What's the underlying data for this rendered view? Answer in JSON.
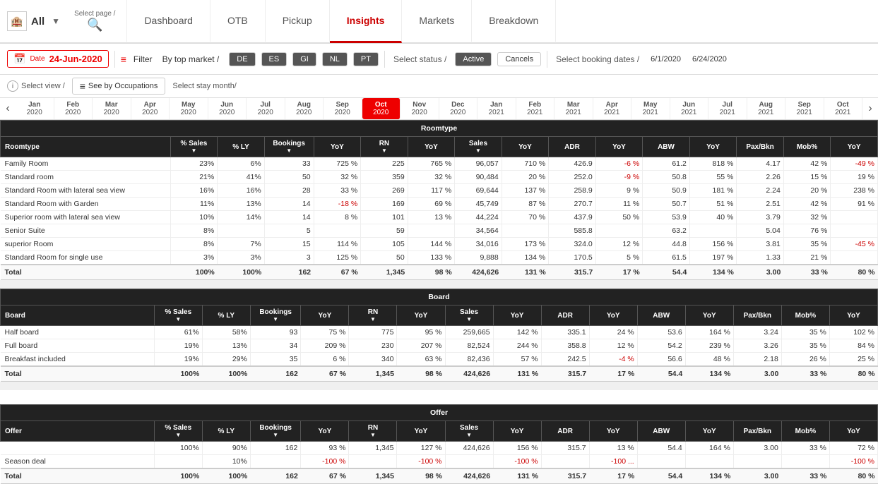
{
  "nav": {
    "logo_label": "All",
    "select_page_label": "Select page /",
    "dashboard": "Dashboard",
    "otb": "OTB",
    "pickup": "Pickup",
    "insights": "Insights",
    "markets": "Markets",
    "breakdown": "Breakdown"
  },
  "filter": {
    "date_label": "Date",
    "date_value": "24-Jun-2020",
    "filter_label": "Filter",
    "by_market": "By top market /",
    "markets": [
      "DE",
      "ES",
      "GI",
      "NL",
      "PT"
    ],
    "status_label": "Select status /",
    "statuses": [
      "Active",
      "Cancels"
    ],
    "active_status": "Active",
    "booking_dates_label": "Select booking dates /",
    "date_from": "6/1/2020",
    "date_to": "6/24/2020"
  },
  "view": {
    "select_label": "Select view /",
    "occupations_btn": "See by Occupations",
    "stay_month_label": "Select stay month/"
  },
  "months": [
    {
      "name": "Jan",
      "year": "2020"
    },
    {
      "name": "Feb",
      "year": "2020"
    },
    {
      "name": "Mar",
      "year": "2020"
    },
    {
      "name": "Apr",
      "year": "2020"
    },
    {
      "name": "May",
      "year": "2020"
    },
    {
      "name": "Jun",
      "year": "2020"
    },
    {
      "name": "Jul",
      "year": "2020"
    },
    {
      "name": "Aug",
      "year": "2020"
    },
    {
      "name": "Sep",
      "year": "2020"
    },
    {
      "name": "Oct",
      "year": "2020"
    },
    {
      "name": "Nov",
      "year": "2020"
    },
    {
      "name": "Dec",
      "year": "2020"
    },
    {
      "name": "Jan",
      "year": "2021"
    },
    {
      "name": "Feb",
      "year": "2021"
    },
    {
      "name": "Mar",
      "year": "2021"
    },
    {
      "name": "Apr",
      "year": "2021"
    },
    {
      "name": "May",
      "year": "2021"
    },
    {
      "name": "Jun",
      "year": "2021"
    },
    {
      "name": "Jul",
      "year": "2021"
    },
    {
      "name": "Aug",
      "year": "2021"
    },
    {
      "name": "Sep",
      "year": "2021"
    },
    {
      "name": "Oct",
      "year": "2021"
    }
  ],
  "active_month_index": 9,
  "roomtype_table": {
    "section_label": "Roomtype",
    "headers": [
      "Roomtype",
      "% Sales",
      "% LY",
      "Bookings",
      "YoY",
      "RN",
      "YoY",
      "Sales",
      "YoY",
      "ADR",
      "YoY",
      "ABW",
      "YoY",
      "Pax/Bkn",
      "Mob%",
      "YoY"
    ],
    "rows": [
      [
        "Family Room",
        "23%",
        "6%",
        "33",
        "725 %",
        "225",
        "765 %",
        "96,057",
        "710 %",
        "426.9",
        "-6 %",
        "61.2",
        "818 %",
        "4.17",
        "42 %",
        "-49 %"
      ],
      [
        "Standard room",
        "21%",
        "41%",
        "50",
        "32 %",
        "359",
        "32 %",
        "90,484",
        "20 %",
        "252.0",
        "-9 %",
        "50.8",
        "55 %",
        "2.26",
        "15 %",
        "19 %"
      ],
      [
        "Standard Room with lateral sea view",
        "16%",
        "16%",
        "28",
        "33 %",
        "269",
        "117 %",
        "69,644",
        "137 %",
        "258.9",
        "9 %",
        "50.9",
        "181 %",
        "2.24",
        "20 %",
        "238 %"
      ],
      [
        "Standard Room with Garden",
        "11%",
        "13%",
        "14",
        "-18 %",
        "169",
        "69 %",
        "45,749",
        "87 %",
        "270.7",
        "11 %",
        "50.7",
        "51 %",
        "2.51",
        "42 %",
        "91 %"
      ],
      [
        "Superior room with lateral sea view",
        "10%",
        "14%",
        "14",
        "8 %",
        "101",
        "13 %",
        "44,224",
        "70 %",
        "437.9",
        "50 %",
        "53.9",
        "40 %",
        "3.79",
        "32 %",
        ""
      ],
      [
        "Senior Suite",
        "8%",
        "",
        "5",
        "",
        "59",
        "",
        "34,564",
        "",
        "585.8",
        "",
        "63.2",
        "",
        "5.04",
        "76 %",
        ""
      ],
      [
        "superior Room",
        "8%",
        "7%",
        "15",
        "114 %",
        "105",
        "144 %",
        "34,016",
        "173 %",
        "324.0",
        "12 %",
        "44.8",
        "156 %",
        "3.81",
        "35 %",
        "-45 %"
      ],
      [
        "Standard Room for single use",
        "3%",
        "3%",
        "3",
        "125 %",
        "50",
        "133 %",
        "9,888",
        "134 %",
        "170.5",
        "5 %",
        "61.5",
        "197 %",
        "1.33",
        "21 %",
        ""
      ],
      [
        "Total",
        "100%",
        "100%",
        "162",
        "67 %",
        "1,345",
        "98 %",
        "424,626",
        "131 %",
        "315.7",
        "17 %",
        "54.4",
        "134 %",
        "3.00",
        "33 %",
        "80 %"
      ]
    ]
  },
  "board_table": {
    "section_label": "Board",
    "headers": [
      "Board",
      "% Sales",
      "% LY",
      "Bookings",
      "YoY",
      "RN",
      "YoY",
      "Sales",
      "YoY",
      "ADR",
      "YoY",
      "ABW",
      "YoY",
      "Pax/Bkn",
      "Mob%",
      "YoY"
    ],
    "rows": [
      [
        "Half board",
        "61%",
        "58%",
        "93",
        "75 %",
        "775",
        "95 %",
        "259,665",
        "142 %",
        "335.1",
        "24 %",
        "53.6",
        "164 %",
        "3.24",
        "35 %",
        "102 %"
      ],
      [
        "Full board",
        "19%",
        "13%",
        "34",
        "209 %",
        "230",
        "207 %",
        "82,524",
        "244 %",
        "358.8",
        "12 %",
        "54.2",
        "239 %",
        "3.26",
        "35 %",
        "84 %"
      ],
      [
        "Breakfast included",
        "19%",
        "29%",
        "35",
        "6 %",
        "340",
        "63 %",
        "82,436",
        "57 %",
        "242.5",
        "-4 %",
        "56.6",
        "48 %",
        "2.18",
        "26 %",
        "25 %"
      ],
      [
        "Total",
        "100%",
        "100%",
        "162",
        "67 %",
        "1,345",
        "98 %",
        "424,626",
        "131 %",
        "315.7",
        "17 %",
        "54.4",
        "134 %",
        "3.00",
        "33 %",
        "80 %"
      ]
    ]
  },
  "offer_table": {
    "section_label": "Offer",
    "headers": [
      "Offer",
      "% Sales",
      "% LY",
      "Bookings",
      "YoY",
      "RN",
      "YoY",
      "Sales",
      "YoY",
      "ADR",
      "YoY",
      "ABW",
      "YoY",
      "Pax/Bkn",
      "Mob%",
      "YoY"
    ],
    "rows": [
      [
        "",
        "100%",
        "90%",
        "162",
        "93 %",
        "1,345",
        "127 %",
        "424,626",
        "156 %",
        "315.7",
        "13 %",
        "54.4",
        "164 %",
        "3.00",
        "33 %",
        "72 %"
      ],
      [
        "Season deal",
        "",
        "10%",
        "",
        "-100 %",
        "",
        "-100 %",
        "",
        "-100 %",
        "",
        "-100 ...",
        "",
        "",
        "",
        "",
        "-100 %"
      ],
      [
        "Total",
        "100%",
        "100%",
        "162",
        "67 %",
        "1,345",
        "98 %",
        "424,626",
        "131 %",
        "315.7",
        "17 %",
        "54.4",
        "134 %",
        "3.00",
        "33 %",
        "80 %"
      ]
    ]
  }
}
